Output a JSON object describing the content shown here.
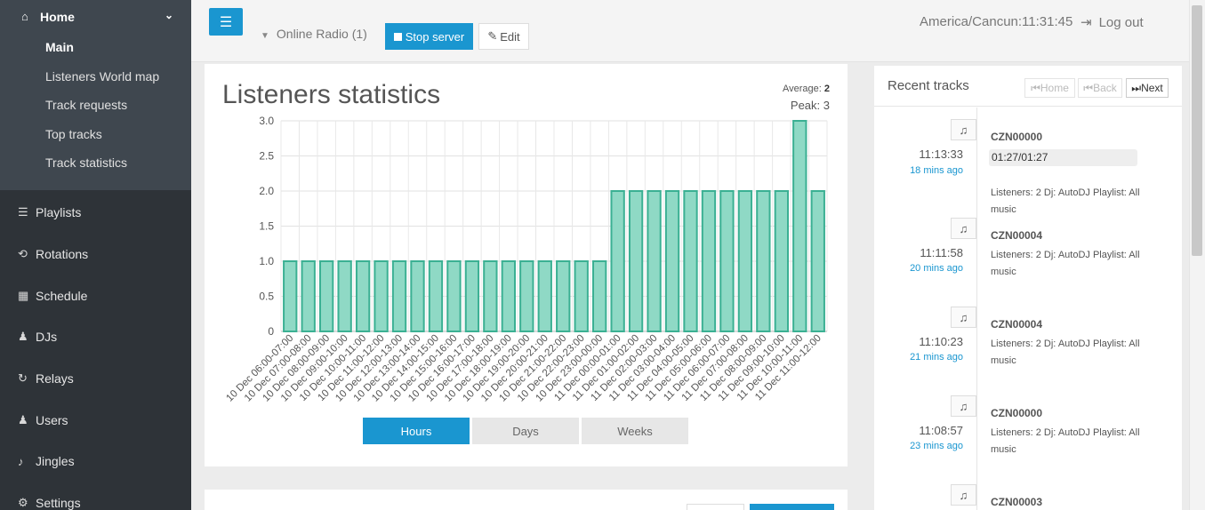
{
  "sidebar": {
    "home": {
      "label": "Home",
      "icon": "home-icon"
    },
    "sub_items": [
      {
        "label": "Main",
        "active": true
      },
      {
        "label": "Listeners World map"
      },
      {
        "label": "Track requests"
      },
      {
        "label": "Top tracks"
      },
      {
        "label": "Track statistics"
      }
    ],
    "items": [
      {
        "label": "Playlists",
        "icon": "list-icon",
        "glyph": "☰"
      },
      {
        "label": "Rotations",
        "icon": "refresh-icon",
        "glyph": "⟲"
      },
      {
        "label": "Schedule",
        "icon": "calendar-icon",
        "glyph": "▦"
      },
      {
        "label": "DJs",
        "icon": "user-icon",
        "glyph": "♟"
      },
      {
        "label": "Relays",
        "icon": "redo-icon",
        "glyph": "↻"
      },
      {
        "label": "Users",
        "icon": "users-icon",
        "glyph": "♟"
      },
      {
        "label": "Jingles",
        "icon": "bell-icon",
        "glyph": "♪"
      },
      {
        "label": "Settings",
        "icon": "cogs-icon",
        "glyph": "⚙"
      }
    ]
  },
  "topbar": {
    "station": "Online Radio (1)",
    "stop_label": "Stop server",
    "edit_label": "Edit",
    "clock": "America/Cancun:11:31:45",
    "logout_label": "Log out"
  },
  "stats": {
    "title": "Listeners statistics",
    "average_label": "Average:",
    "average_value": "2",
    "peak": "Peak: 3",
    "tabs": [
      "Hours",
      "Days",
      "Weeks"
    ],
    "active_tab": "Hours"
  },
  "chart_data": {
    "type": "bar",
    "categories": [
      "10 Dec 06:00-07:00",
      "10 Dec 07:00-08:00",
      "10 Dec 08:00-09:00",
      "10 Dec 09:00-10:00",
      "10 Dec 10:00-11:00",
      "10 Dec 11:00-12:00",
      "10 Dec 12:00-13:00",
      "10 Dec 13:00-14:00",
      "10 Dec 14:00-15:00",
      "10 Dec 15:00-16:00",
      "10 Dec 16:00-17:00",
      "10 Dec 17:00-18:00",
      "10 Dec 18:00-19:00",
      "10 Dec 19:00-20:00",
      "10 Dec 20:00-21:00",
      "10 Dec 21:00-22:00",
      "10 Dec 22:00-23:00",
      "10 Dec 23:00-00:00",
      "11 Dec 00:00-01:00",
      "11 Dec 01:00-02:00",
      "11 Dec 02:00-03:00",
      "11 Dec 03:00-04:00",
      "11 Dec 04:00-05:00",
      "11 Dec 05:00-06:00",
      "11 Dec 06:00-07:00",
      "11 Dec 07:00-08:00",
      "11 Dec 08:00-09:00",
      "11 Dec 09:00-10:00",
      "11 Dec 10:00-11:00",
      "11 Dec 11:00-12:00"
    ],
    "values": [
      1,
      1,
      1,
      1,
      1,
      1,
      1,
      1,
      1,
      1,
      1,
      1,
      1,
      1,
      1,
      1,
      1,
      1,
      2,
      2,
      2,
      2,
      2,
      2,
      2,
      2,
      2,
      2,
      3,
      2
    ],
    "yticks": [
      "0",
      "0.5",
      "1.0",
      "1.5",
      "2.0",
      "2.5",
      "3.0"
    ],
    "ylim": [
      0,
      3
    ],
    "grid": true,
    "bar_color": "#8fd9c5",
    "bar_border": "#3bb093"
  },
  "recent": {
    "title": "Recent tracks",
    "nav": {
      "home": "Home",
      "back": "Back",
      "next": "Next"
    },
    "tracks": [
      {
        "time": "11:13:33",
        "ago": "18 mins ago",
        "title": "CZN00000",
        "progress": "01:27/01:27",
        "meta": "Listeners: 2 Dj: AutoDJ Playlist: All music"
      },
      {
        "time": "11:11:58",
        "ago": "20 mins ago",
        "title": "CZN00004",
        "meta": "Listeners: 2 Dj: AutoDJ Playlist: All music"
      },
      {
        "time": "11:10:23",
        "ago": "21 mins ago",
        "title": "CZN00004",
        "meta": "Listeners: 2 Dj: AutoDJ Playlist: All music"
      },
      {
        "time": "11:08:57",
        "ago": "23 mins ago",
        "title": "CZN00000",
        "meta": "Listeners: 2 Dj: AutoDJ Playlist: All music"
      },
      {
        "time": "",
        "ago": "",
        "title": "CZN00003",
        "meta": ""
      }
    ]
  }
}
